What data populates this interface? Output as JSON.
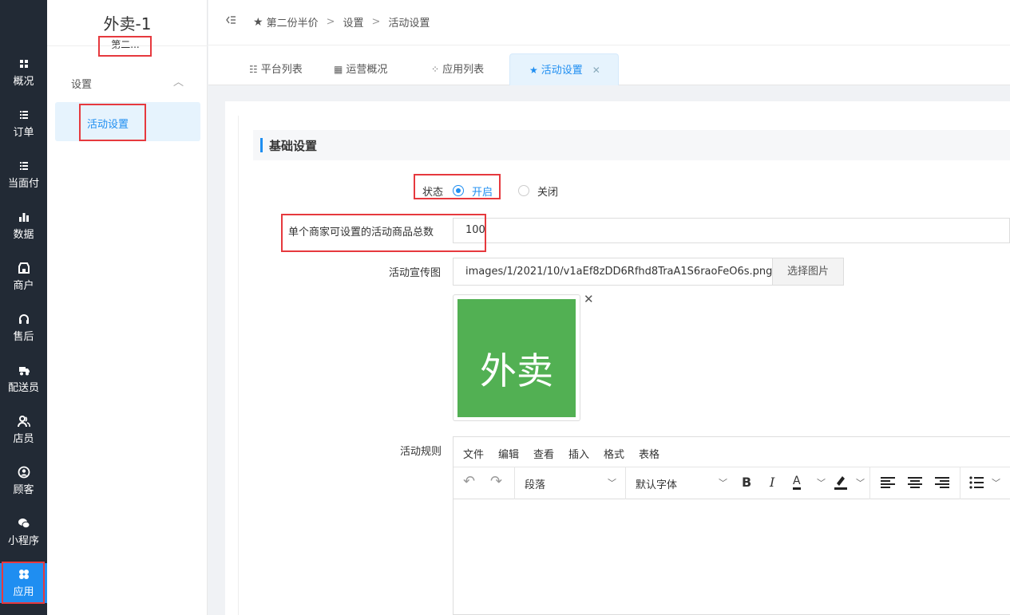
{
  "nav": [
    {
      "label": "概况",
      "icon": "grid-icon"
    },
    {
      "label": "订单",
      "icon": "list-icon"
    },
    {
      "label": "当面付",
      "icon": "list-icon"
    },
    {
      "label": "数据",
      "icon": "bar-chart-icon"
    },
    {
      "label": "商户",
      "icon": "store-icon"
    },
    {
      "label": "售后",
      "icon": "headset-icon"
    },
    {
      "label": "配送员",
      "icon": "delivery-icon"
    },
    {
      "label": "店员",
      "icon": "users-icon"
    },
    {
      "label": "顾客",
      "icon": "user-circle-icon"
    },
    {
      "label": "小程序",
      "icon": "wechat-icon"
    },
    {
      "label": "应用",
      "icon": "apps-icon",
      "active": true
    }
  ],
  "sidebar": {
    "title": "外卖-1",
    "subtitle": "第二...",
    "group": "设置",
    "item": "活动设置"
  },
  "breadcrumb": {
    "root": "第二份半价",
    "level1": "设置",
    "level2": "活动设置",
    "sep": ">"
  },
  "tabs": [
    {
      "label": "平台列表"
    },
    {
      "label": "运营概况"
    },
    {
      "label": "应用列表"
    },
    {
      "label": "活动设置",
      "active": true
    }
  ],
  "section": {
    "title": "基础设置"
  },
  "form": {
    "status_label": "状态",
    "status_on": "开启",
    "status_off": "关闭",
    "status_value": "开启",
    "max_goods_label": "单个商家可设置的活动商品总数",
    "max_goods_value": "100",
    "banner_label": "活动宣传图",
    "banner_path": "images/1/2021/10/v1aEf8zDD6Rfhd8TraA1S6raoFeO6s.png",
    "banner_button": "选择图片",
    "banner_preview_text": "外卖",
    "rules_label": "活动规则"
  },
  "editor": {
    "menus": [
      "文件",
      "编辑",
      "查看",
      "插入",
      "格式",
      "表格"
    ],
    "block_format": "段落",
    "font_family": "默认字体"
  },
  "colors": {
    "accent": "#1f8ef1",
    "nav_bg": "#222a35",
    "highlight_box": "#e6393e",
    "banner_green": "#52b053"
  }
}
